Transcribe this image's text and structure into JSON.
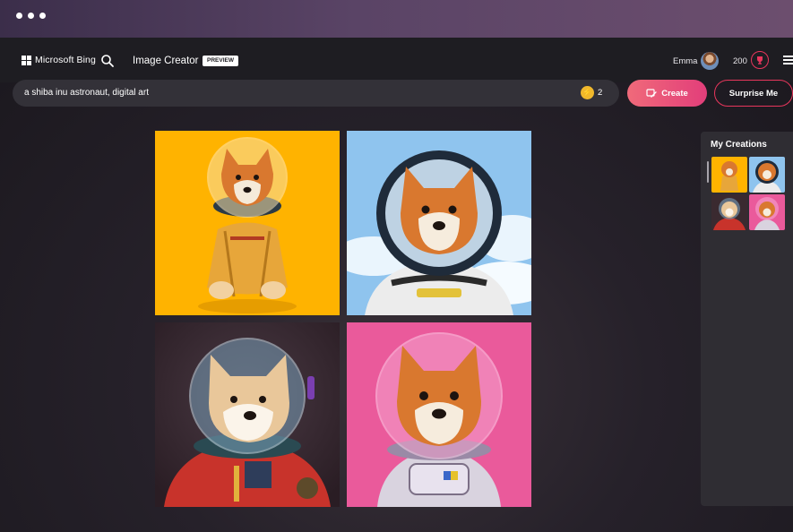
{
  "header": {
    "brand": "Microsoft Bing",
    "nav_title": "Image Creator",
    "badge": "PREVIEW",
    "user_name": "Emma",
    "reward_points": "200"
  },
  "prompt": {
    "value": "a shiba inu astronaut, digital art",
    "boosts": "2"
  },
  "actions": {
    "create_label": "Create",
    "surprise_label": "Surprise Me"
  },
  "results": {
    "images": [
      {
        "icon": "shiba-astronaut-yellow-image",
        "background": "#ffb300"
      },
      {
        "icon": "shiba-astronaut-sky-image",
        "background": "#8fc4ee"
      },
      {
        "icon": "shiba-astronaut-red-suit-image",
        "background": "#3a2a30"
      },
      {
        "icon": "shiba-astronaut-pink-image",
        "background": "#ea5a9b"
      }
    ]
  },
  "sidebar": {
    "title": "My Creations",
    "thumbnails": [
      {
        "icon": "creation-thumbnail-icon",
        "background": "#ffb300"
      },
      {
        "icon": "creation-thumbnail-icon",
        "background": "#8fc4ee"
      },
      {
        "icon": "creation-thumbnail-icon",
        "background": "#3a2a30"
      },
      {
        "icon": "creation-thumbnail-icon",
        "background": "#ea5a9b"
      }
    ]
  },
  "colors": {
    "accent": "#e8365c",
    "chrome": "#1e1d22",
    "prompt_bg": "#333138"
  }
}
